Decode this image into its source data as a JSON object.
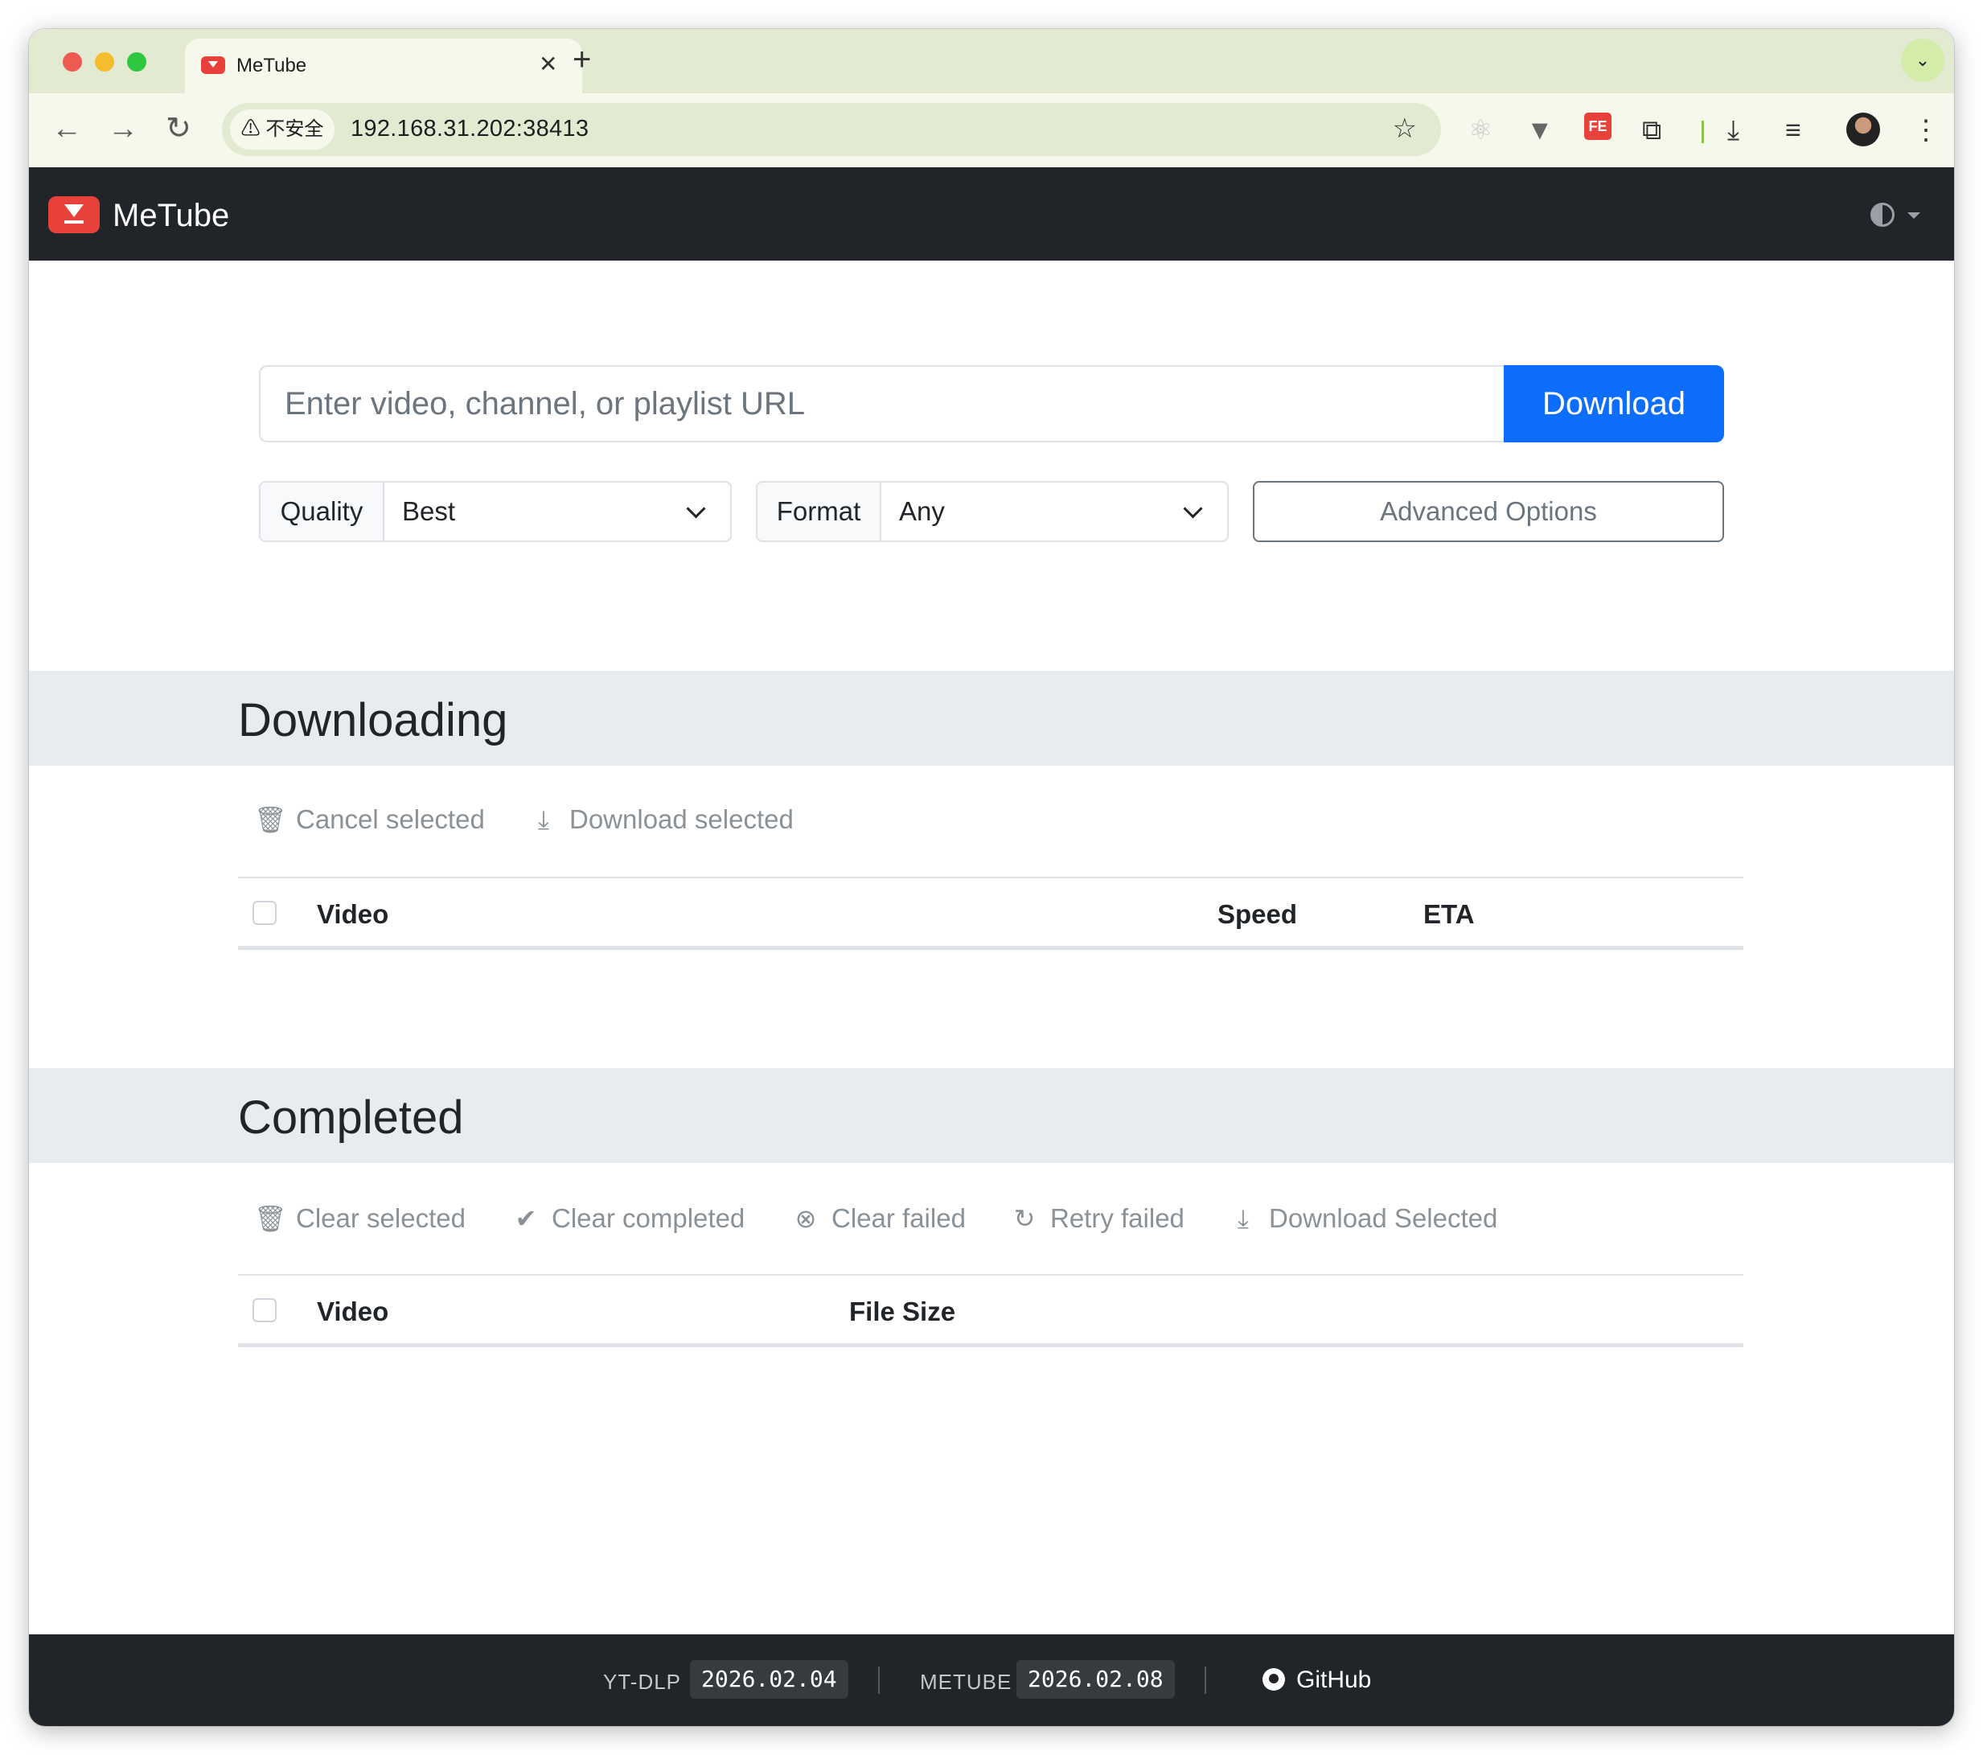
{
  "browser": {
    "tab_title": "MeTube",
    "security_label": "⚠ 不安全",
    "url": "192.168.31.202:38413"
  },
  "navbar": {
    "brand": "MeTube"
  },
  "add_form": {
    "url_placeholder": "Enter video, channel, or playlist URL",
    "download_label": "Download",
    "quality_label": "Quality",
    "quality_value": "Best",
    "format_label": "Format",
    "format_value": "Any",
    "advanced_label": "Advanced Options"
  },
  "downloading": {
    "title": "Downloading",
    "actions": {
      "cancel": "Cancel selected",
      "download": "Download selected"
    },
    "columns": {
      "video": "Video",
      "speed": "Speed",
      "eta": "ETA"
    }
  },
  "completed": {
    "title": "Completed",
    "actions": {
      "clear_selected": "Clear selected",
      "clear_completed": "Clear completed",
      "clear_failed": "Clear failed",
      "retry_failed": "Retry failed",
      "download_selected": "Download Selected"
    },
    "columns": {
      "video": "Video",
      "file_size": "File Size"
    }
  },
  "footer": {
    "ytdlp_label": "YT-DLP",
    "ytdlp_version": "2026.02.04",
    "metube_label": "METUBE",
    "metube_version": "2026.02.08",
    "github_label": "GitHub"
  },
  "colors": {
    "accent": "#0d6efd",
    "navbar_bg": "#212529",
    "brand_red": "#e8403a",
    "section_bg": "#e9ecef"
  }
}
